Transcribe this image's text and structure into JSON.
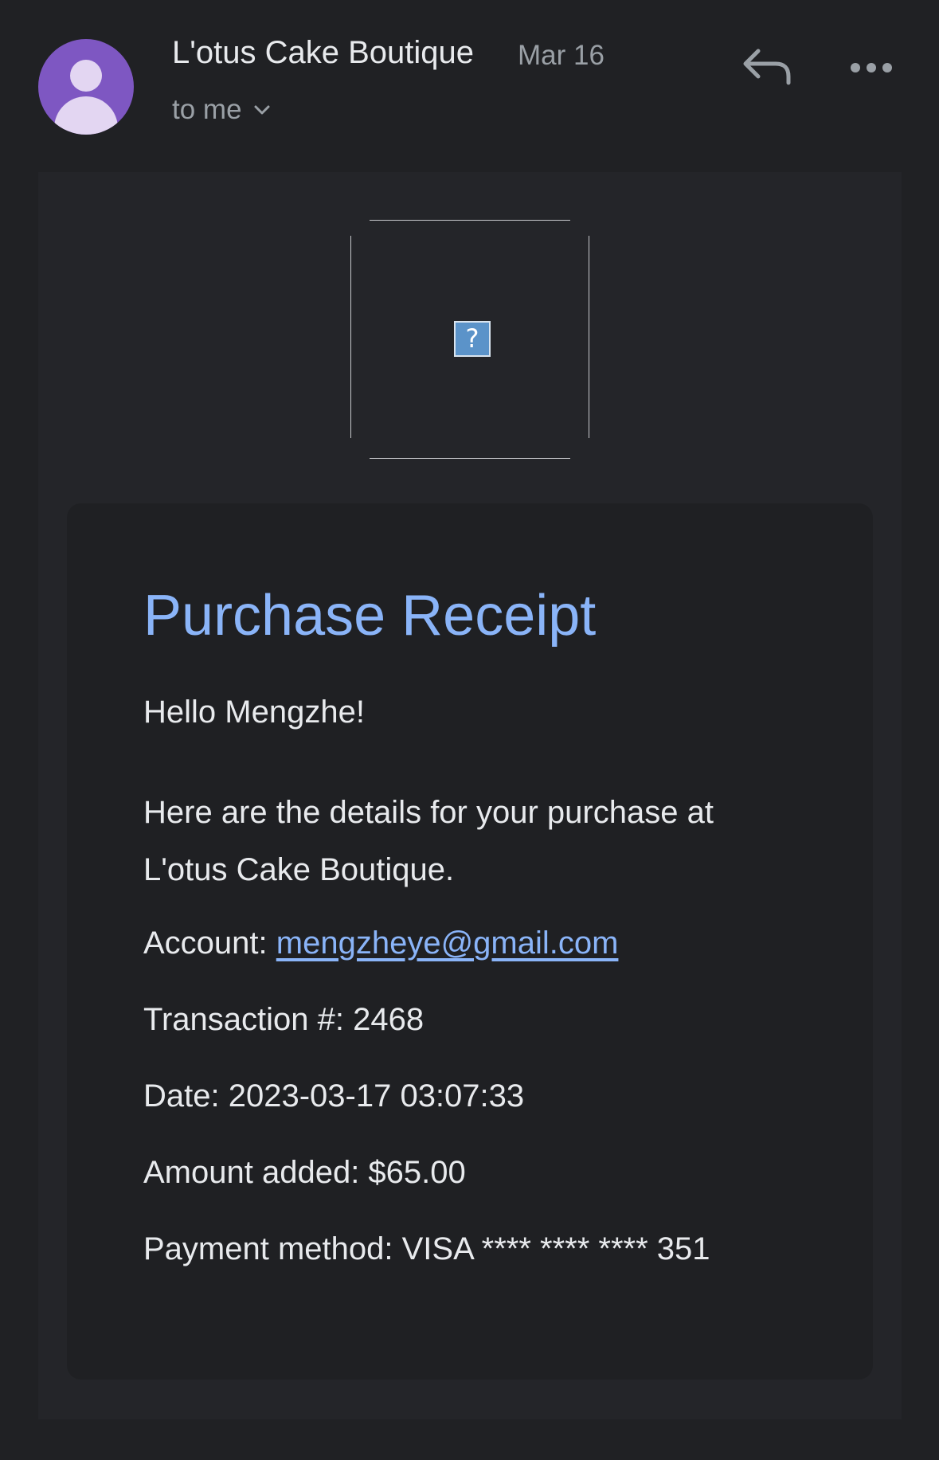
{
  "header": {
    "sender": "L'otus Cake Boutique",
    "date": "Mar 16",
    "recipient_label": "to me",
    "avatar_color": "#7e57c2",
    "icons": {
      "reply": "reply-icon",
      "more": "more-horizontal-icon",
      "expand": "chevron-down-icon"
    }
  },
  "email": {
    "image_placeholder_glyph": "?",
    "title": "Purchase Receipt",
    "greeting": "Hello Mengzhe!",
    "intro": "Here are the details for your purchase at L'otus Cake Boutique.",
    "account_label": "Account: ",
    "account_email": "mengzheye@gmail.com",
    "transaction_label": "Transaction #: ",
    "transaction_value": "2468",
    "date_label": "Date: ",
    "date_value": "2023-03-17 03:07:33",
    "amount_label": "Amount added: ",
    "amount_value": "$65.00",
    "payment_label": "Payment method: ",
    "payment_value": "VISA **** **** **** 351",
    "accent_color": "#8ab4f8"
  }
}
